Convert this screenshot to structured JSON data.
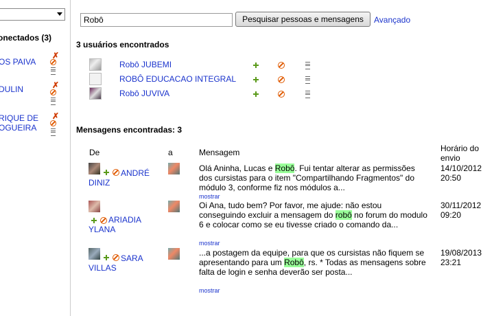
{
  "left_panel": {
    "online_title": "onectados (3)",
    "contacts": [
      {
        "lines": [
          "OS PAIVA"
        ]
      },
      {
        "lines": [
          "DULIN"
        ]
      },
      {
        "lines": [
          "RIQUE DE",
          "OGUEIRA"
        ]
      }
    ]
  },
  "search": {
    "value": "Robô",
    "button_label": "Pesquisar pessoas e mensagens",
    "advanced_label": "Avançado"
  },
  "users_section": {
    "title": "3 usuários encontrados",
    "users": [
      {
        "name": "Robô JUBEMI"
      },
      {
        "name": "ROBÔ EDUCACAO INTEGRAL"
      },
      {
        "name": "Robô JUVIVA"
      }
    ]
  },
  "messages_section": {
    "title": "Mensagens encontradas: 3",
    "headers": {
      "from": "De",
      "to": "a",
      "message": "Mensagem",
      "date_line1": "Horário do",
      "date_line2": "envio"
    },
    "show_label": "mostrar",
    "messages": [
      {
        "from_line1": "ANDRÉ",
        "from_line2": "DINIZ",
        "t1": "Olá Aninha, Lucas e ",
        "h1": "Robô",
        "t2": ". Fui tentar alterar as permissões dos cursistas para o item \"Compartilhando Fragmentos\" do módulo 3, conforme fiz nos módulos a...",
        "date1": "14/10/2012",
        "date2": "20:50"
      },
      {
        "from_line1": "ARIADIA",
        "from_line2": "YLANA",
        "t1": "Oi Ana, tudo bem? Por favor, me ajude: não estou conseguindo excluir a mensagem do ",
        "h1": "robô",
        "t2": " no forum do modulo 6 e colocar como se eu tivesse criado o comando da...",
        "date1": "30/11/2012",
        "date2": "09:20"
      },
      {
        "from_line1": "SARA",
        "from_line2": "VILLAS",
        "t1": "...a postagem da equipe, para que os cursistas não fiquem se apresentando para um ",
        "h1": "Robô",
        "t2": ", rs. * Todas as mensagens sobre falta de login e senha deverão ser posta...",
        "date1": "19/08/2013",
        "date2": "23:21"
      }
    ]
  },
  "colors": {
    "link": "#1a33cc",
    "highlight": "#99ff99",
    "block": "#e05a00",
    "add": "#5a9a1a"
  }
}
